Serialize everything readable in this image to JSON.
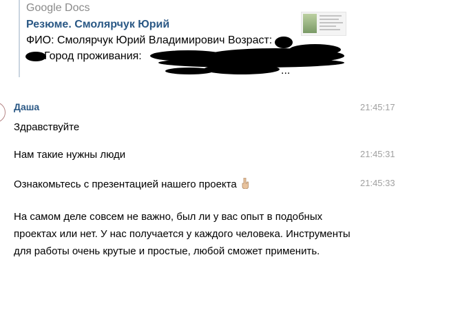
{
  "preview": {
    "site": "Google Docs",
    "title": "Резюме. Смолярчук Юрий",
    "desc_line1": "ФИО: Смолярчук Юрий Владимирович Возраст:",
    "desc_line2": "Город проживания:",
    "desc_end": "..."
  },
  "messages": {
    "author": "Даша",
    "items": [
      {
        "text": "Здравствуйте",
        "time": "21:45:17"
      },
      {
        "text": "Нам такие нужны люди",
        "time": "21:45:31"
      },
      {
        "text": "Ознакомьтесь  с презентацией нашего проекта",
        "time": "21:45:33",
        "icon": "pointing-down-hand-icon"
      }
    ],
    "long_text": "На самом деле совсем не важно, был ли у вас опыт в подобных проектах или нет. У нас получается у каждого человека. Инструменты для работы очень крутые и простые, любой сможет применить."
  }
}
